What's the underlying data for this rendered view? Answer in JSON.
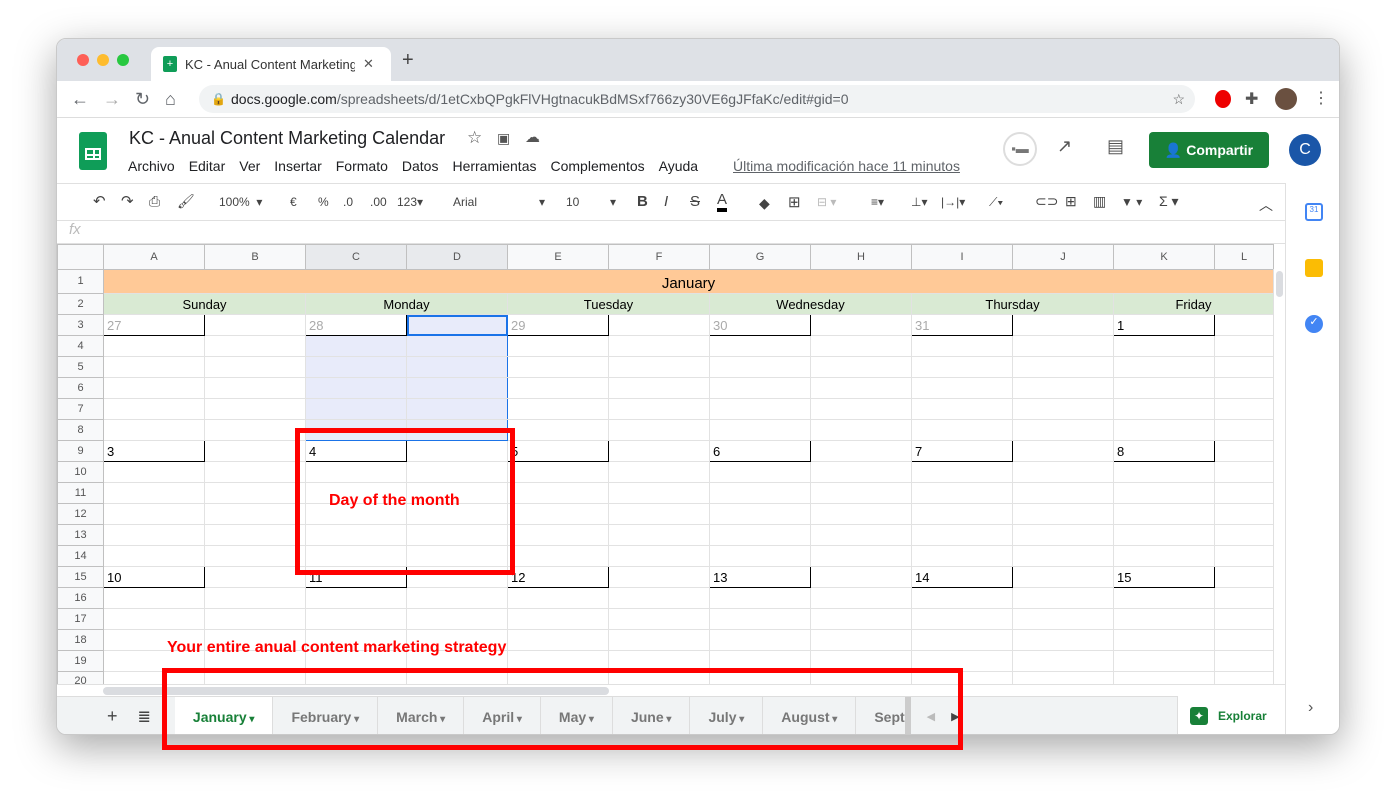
{
  "browser": {
    "tab_title": "KC - Anual Content Marketing C",
    "url_host": "docs.google.com",
    "url_path": "/spreadsheets/d/1etCxbQPgkFlVHgtnacukBdMSxf766zy30VE6gJFfaKc/edit#gid=0"
  },
  "doc": {
    "title": "KC - Anual Content Marketing Calendar",
    "menu": [
      "Archivo",
      "Editar",
      "Ver",
      "Insertar",
      "Formato",
      "Datos",
      "Herramientas",
      "Complementos",
      "Ayuda"
    ],
    "last_modified": "Última modificación hace 11 minutos",
    "share_label": "Compartir",
    "avatar_letter": "C"
  },
  "toolbar": {
    "zoom": "100%",
    "currency": "€",
    "percent": "%",
    "dec_less": ".0",
    "dec_more": ".00",
    "format": "123",
    "font": "Arial",
    "font_size": "10"
  },
  "formula_bar": {
    "fx": "fx",
    "value": ""
  },
  "grid": {
    "columns": [
      "A",
      "B",
      "C",
      "D",
      "E",
      "F",
      "G",
      "H",
      "I",
      "J",
      "K",
      "L"
    ],
    "row_count": 20,
    "month_title": "January",
    "days": [
      "Sunday",
      "Monday",
      "Tuesday",
      "Wednesday",
      "Thursday",
      "Friday"
    ],
    "weeks": [
      {
        "dates": [
          "27",
          "28",
          "29",
          "30",
          "31",
          "1"
        ],
        "muted": [
          true,
          true,
          true,
          true,
          true,
          false
        ]
      },
      {
        "dates": [
          "3",
          "4",
          "5",
          "6",
          "7",
          "8"
        ],
        "muted": [
          false,
          false,
          false,
          false,
          false,
          false
        ]
      },
      {
        "dates": [
          "10",
          "11",
          "12",
          "13",
          "14",
          "15"
        ],
        "muted": [
          false,
          false,
          false,
          false,
          false,
          false
        ]
      }
    ],
    "header_color": "#ffc997",
    "day_color": "#d9ead3"
  },
  "sheet_tabs": [
    "January",
    "February",
    "March",
    "April",
    "May",
    "June",
    "July",
    "August",
    "Sept"
  ],
  "active_sheet": "January",
  "explore_label": "Explorar",
  "annotations": {
    "day_label": "Day of the month",
    "strategy_label": "Your entire anual content marketing strategy",
    "color": "#ff0000"
  }
}
